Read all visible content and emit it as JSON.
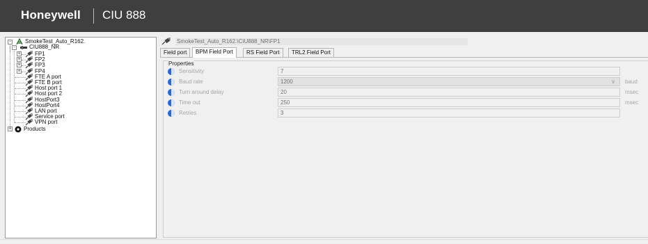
{
  "header": {
    "brand": "Honeywell",
    "product": "CIU 888"
  },
  "tree": {
    "root": "SmokeTest_Auto_R162.",
    "controller": "CIU888_NR",
    "ports": [
      {
        "label": "FP1",
        "expandable": true
      },
      {
        "label": "FP2",
        "expandable": true
      },
      {
        "label": "FP3",
        "expandable": true
      },
      {
        "label": "FP4",
        "expandable": true
      },
      {
        "label": "FTE A port",
        "expandable": false
      },
      {
        "label": "FTE B port",
        "expandable": false
      },
      {
        "label": "Host port 1",
        "expandable": false
      },
      {
        "label": "Host port 2",
        "expandable": false
      },
      {
        "label": "HostPort3",
        "expandable": false
      },
      {
        "label": "HostPort4",
        "expandable": false
      },
      {
        "label": "LAN port",
        "expandable": false
      },
      {
        "label": "Service port",
        "expandable": false
      },
      {
        "label": "VPN port",
        "expandable": false
      }
    ],
    "products": "Products"
  },
  "path": "SmokeTest_Auto_R162.\\CIU888_NR\\FP1",
  "tabs": [
    {
      "label": "Field port",
      "active": false
    },
    {
      "label": "BPM Field Port",
      "active": true
    },
    {
      "label": "RS Field Port",
      "active": false
    },
    {
      "label": "TRL2 Field Port",
      "active": false
    }
  ],
  "properties": {
    "title": "Properties",
    "rows": [
      {
        "label": "Sensitivity",
        "value": "7",
        "unit": "",
        "select": false
      },
      {
        "label": "Baud rate",
        "value": "1200",
        "unit": "baud",
        "select": true
      },
      {
        "label": "Turn around delay",
        "value": "20",
        "unit": "msec",
        "select": false
      },
      {
        "label": "Time out",
        "value": "250",
        "unit": "msec",
        "select": false
      },
      {
        "label": "Retries",
        "value": "3",
        "unit": "",
        "select": false
      }
    ]
  },
  "icons": {
    "root": "network-root-icon",
    "controller": "controller-icon",
    "port": "port-plug-icon",
    "products": "products-icon",
    "info": "info-icon",
    "dropdown": "chevron-down-icon"
  },
  "colors": {
    "header_bg": "#3f3f3f",
    "info_icon": "#2f66c9"
  }
}
